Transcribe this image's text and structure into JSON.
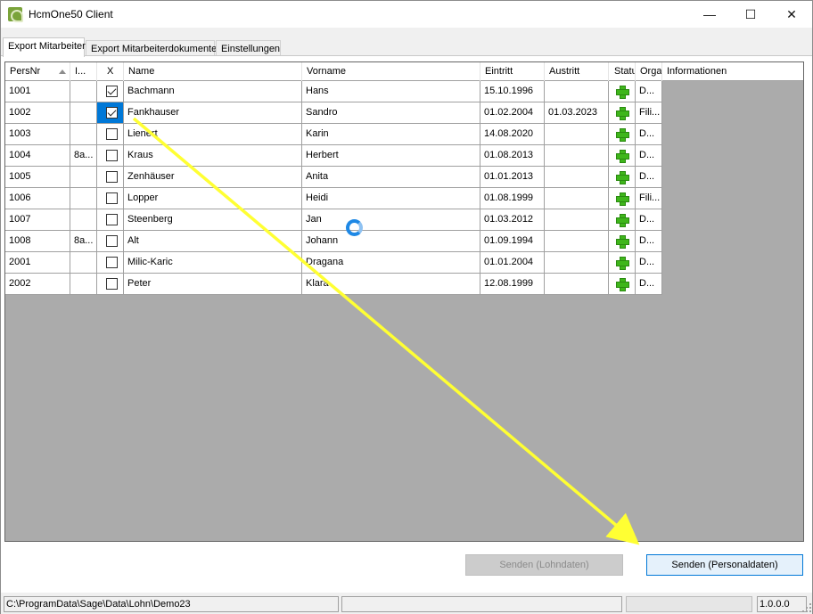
{
  "window": {
    "title": "HcmOne50 Client",
    "minimize": "—",
    "maximize": "☐",
    "close": "✕"
  },
  "tabs": [
    {
      "label": "Export Mitarbeiter",
      "active": true
    },
    {
      "label": "Export Mitarbeiterdokumente",
      "active": false
    },
    {
      "label": "Einstellungen",
      "active": false
    }
  ],
  "grid": {
    "columns": [
      "PersNr",
      "I...",
      "X",
      "Name",
      "Vorname",
      "Eintritt",
      "Austritt",
      "Statu",
      "Orga",
      "Informationen"
    ],
    "rows": [
      {
        "persnr": "1001",
        "i": "",
        "checked": true,
        "name": "Bachmann",
        "vorname": "Hans",
        "eintritt": "15.10.1996",
        "austritt": "",
        "orga": "D...",
        "info": ""
      },
      {
        "persnr": "1002",
        "i": "",
        "checked": true,
        "name": "Fankhauser",
        "vorname": "Sandro",
        "eintritt": "01.02.2004",
        "austritt": "01.03.2023",
        "orga": "Fili...",
        "info": ""
      },
      {
        "persnr": "1003",
        "i": "",
        "checked": false,
        "name": "Lienert",
        "vorname": "Karin",
        "eintritt": "14.08.2020",
        "austritt": "",
        "orga": "D...",
        "info": ""
      },
      {
        "persnr": "1004",
        "i": "8a...",
        "checked": false,
        "name": "Kraus",
        "vorname": "Herbert",
        "eintritt": "01.08.2013",
        "austritt": "",
        "orga": "D...",
        "info": ""
      },
      {
        "persnr": "1005",
        "i": "",
        "checked": false,
        "name": "Zenhäuser",
        "vorname": "Anita",
        "eintritt": "01.01.2013",
        "austritt": "",
        "orga": "D...",
        "info": ""
      },
      {
        "persnr": "1006",
        "i": "",
        "checked": false,
        "name": "Lopper",
        "vorname": "Heidi",
        "eintritt": "01.08.1999",
        "austritt": "",
        "orga": "Fili...",
        "info": ""
      },
      {
        "persnr": "1007",
        "i": "",
        "checked": false,
        "name": "Steenberg",
        "vorname": "Jan",
        "eintritt": "01.03.2012",
        "austritt": "",
        "orga": "D...",
        "info": ""
      },
      {
        "persnr": "1008",
        "i": "8a...",
        "checked": false,
        "name": "Alt",
        "vorname": "Johann",
        "eintritt": "01.09.1994",
        "austritt": "",
        "orga": "D...",
        "info": ""
      },
      {
        "persnr": "2001",
        "i": "",
        "checked": false,
        "name": "Milic-Karic",
        "vorname": "Dragana",
        "eintritt": "01.01.2004",
        "austritt": "",
        "orga": "D...",
        "info": ""
      },
      {
        "persnr": "2002",
        "i": "",
        "checked": false,
        "name": "Peter",
        "vorname": "Klara",
        "eintritt": "12.08.1999",
        "austritt": "",
        "orga": "D...",
        "info": ""
      }
    ]
  },
  "buttons": {
    "send_payroll": "Senden (Lohndaten)",
    "send_personnel": "Senden (Personaldaten)"
  },
  "statusbar": {
    "path": "C:\\ProgramData\\Sage\\Data\\Lohn\\Demo23",
    "version": "1.0.0.0"
  },
  "colors": {
    "selection": "#0078d7",
    "status_plus": "#3fb61b",
    "arrow": "#ffff33",
    "busy": "#1e88e5"
  }
}
